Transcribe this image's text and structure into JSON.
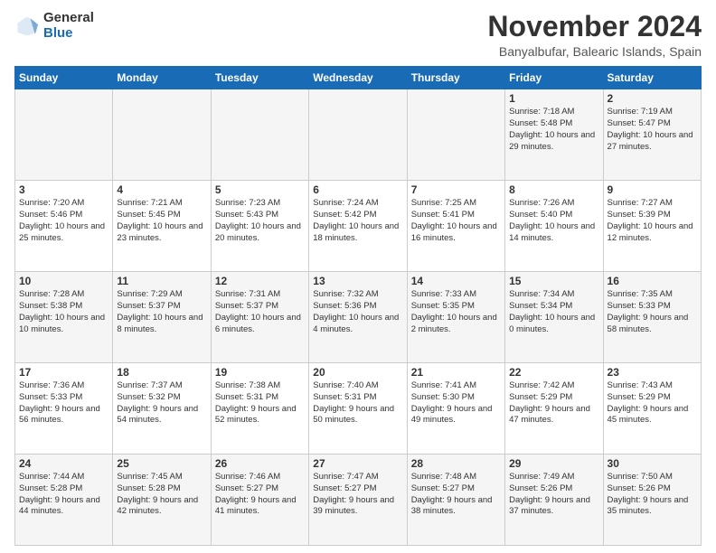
{
  "logo": {
    "general": "General",
    "blue": "Blue"
  },
  "title": "November 2024",
  "location": "Banyalbufar, Balearic Islands, Spain",
  "days_of_week": [
    "Sunday",
    "Monday",
    "Tuesday",
    "Wednesday",
    "Thursday",
    "Friday",
    "Saturday"
  ],
  "weeks": [
    [
      {
        "day": "",
        "info": ""
      },
      {
        "day": "",
        "info": ""
      },
      {
        "day": "",
        "info": ""
      },
      {
        "day": "",
        "info": ""
      },
      {
        "day": "",
        "info": ""
      },
      {
        "day": "1",
        "info": "Sunrise: 7:18 AM\nSunset: 5:48 PM\nDaylight: 10 hours and 29 minutes."
      },
      {
        "day": "2",
        "info": "Sunrise: 7:19 AM\nSunset: 5:47 PM\nDaylight: 10 hours and 27 minutes."
      }
    ],
    [
      {
        "day": "3",
        "info": "Sunrise: 7:20 AM\nSunset: 5:46 PM\nDaylight: 10 hours and 25 minutes."
      },
      {
        "day": "4",
        "info": "Sunrise: 7:21 AM\nSunset: 5:45 PM\nDaylight: 10 hours and 23 minutes."
      },
      {
        "day": "5",
        "info": "Sunrise: 7:23 AM\nSunset: 5:43 PM\nDaylight: 10 hours and 20 minutes."
      },
      {
        "day": "6",
        "info": "Sunrise: 7:24 AM\nSunset: 5:42 PM\nDaylight: 10 hours and 18 minutes."
      },
      {
        "day": "7",
        "info": "Sunrise: 7:25 AM\nSunset: 5:41 PM\nDaylight: 10 hours and 16 minutes."
      },
      {
        "day": "8",
        "info": "Sunrise: 7:26 AM\nSunset: 5:40 PM\nDaylight: 10 hours and 14 minutes."
      },
      {
        "day": "9",
        "info": "Sunrise: 7:27 AM\nSunset: 5:39 PM\nDaylight: 10 hours and 12 minutes."
      }
    ],
    [
      {
        "day": "10",
        "info": "Sunrise: 7:28 AM\nSunset: 5:38 PM\nDaylight: 10 hours and 10 minutes."
      },
      {
        "day": "11",
        "info": "Sunrise: 7:29 AM\nSunset: 5:37 PM\nDaylight: 10 hours and 8 minutes."
      },
      {
        "day": "12",
        "info": "Sunrise: 7:31 AM\nSunset: 5:37 PM\nDaylight: 10 hours and 6 minutes."
      },
      {
        "day": "13",
        "info": "Sunrise: 7:32 AM\nSunset: 5:36 PM\nDaylight: 10 hours and 4 minutes."
      },
      {
        "day": "14",
        "info": "Sunrise: 7:33 AM\nSunset: 5:35 PM\nDaylight: 10 hours and 2 minutes."
      },
      {
        "day": "15",
        "info": "Sunrise: 7:34 AM\nSunset: 5:34 PM\nDaylight: 10 hours and 0 minutes."
      },
      {
        "day": "16",
        "info": "Sunrise: 7:35 AM\nSunset: 5:33 PM\nDaylight: 9 hours and 58 minutes."
      }
    ],
    [
      {
        "day": "17",
        "info": "Sunrise: 7:36 AM\nSunset: 5:33 PM\nDaylight: 9 hours and 56 minutes."
      },
      {
        "day": "18",
        "info": "Sunrise: 7:37 AM\nSunset: 5:32 PM\nDaylight: 9 hours and 54 minutes."
      },
      {
        "day": "19",
        "info": "Sunrise: 7:38 AM\nSunset: 5:31 PM\nDaylight: 9 hours and 52 minutes."
      },
      {
        "day": "20",
        "info": "Sunrise: 7:40 AM\nSunset: 5:31 PM\nDaylight: 9 hours and 50 minutes."
      },
      {
        "day": "21",
        "info": "Sunrise: 7:41 AM\nSunset: 5:30 PM\nDaylight: 9 hours and 49 minutes."
      },
      {
        "day": "22",
        "info": "Sunrise: 7:42 AM\nSunset: 5:29 PM\nDaylight: 9 hours and 47 minutes."
      },
      {
        "day": "23",
        "info": "Sunrise: 7:43 AM\nSunset: 5:29 PM\nDaylight: 9 hours and 45 minutes."
      }
    ],
    [
      {
        "day": "24",
        "info": "Sunrise: 7:44 AM\nSunset: 5:28 PM\nDaylight: 9 hours and 44 minutes."
      },
      {
        "day": "25",
        "info": "Sunrise: 7:45 AM\nSunset: 5:28 PM\nDaylight: 9 hours and 42 minutes."
      },
      {
        "day": "26",
        "info": "Sunrise: 7:46 AM\nSunset: 5:27 PM\nDaylight: 9 hours and 41 minutes."
      },
      {
        "day": "27",
        "info": "Sunrise: 7:47 AM\nSunset: 5:27 PM\nDaylight: 9 hours and 39 minutes."
      },
      {
        "day": "28",
        "info": "Sunrise: 7:48 AM\nSunset: 5:27 PM\nDaylight: 9 hours and 38 minutes."
      },
      {
        "day": "29",
        "info": "Sunrise: 7:49 AM\nSunset: 5:26 PM\nDaylight: 9 hours and 37 minutes."
      },
      {
        "day": "30",
        "info": "Sunrise: 7:50 AM\nSunset: 5:26 PM\nDaylight: 9 hours and 35 minutes."
      }
    ]
  ]
}
